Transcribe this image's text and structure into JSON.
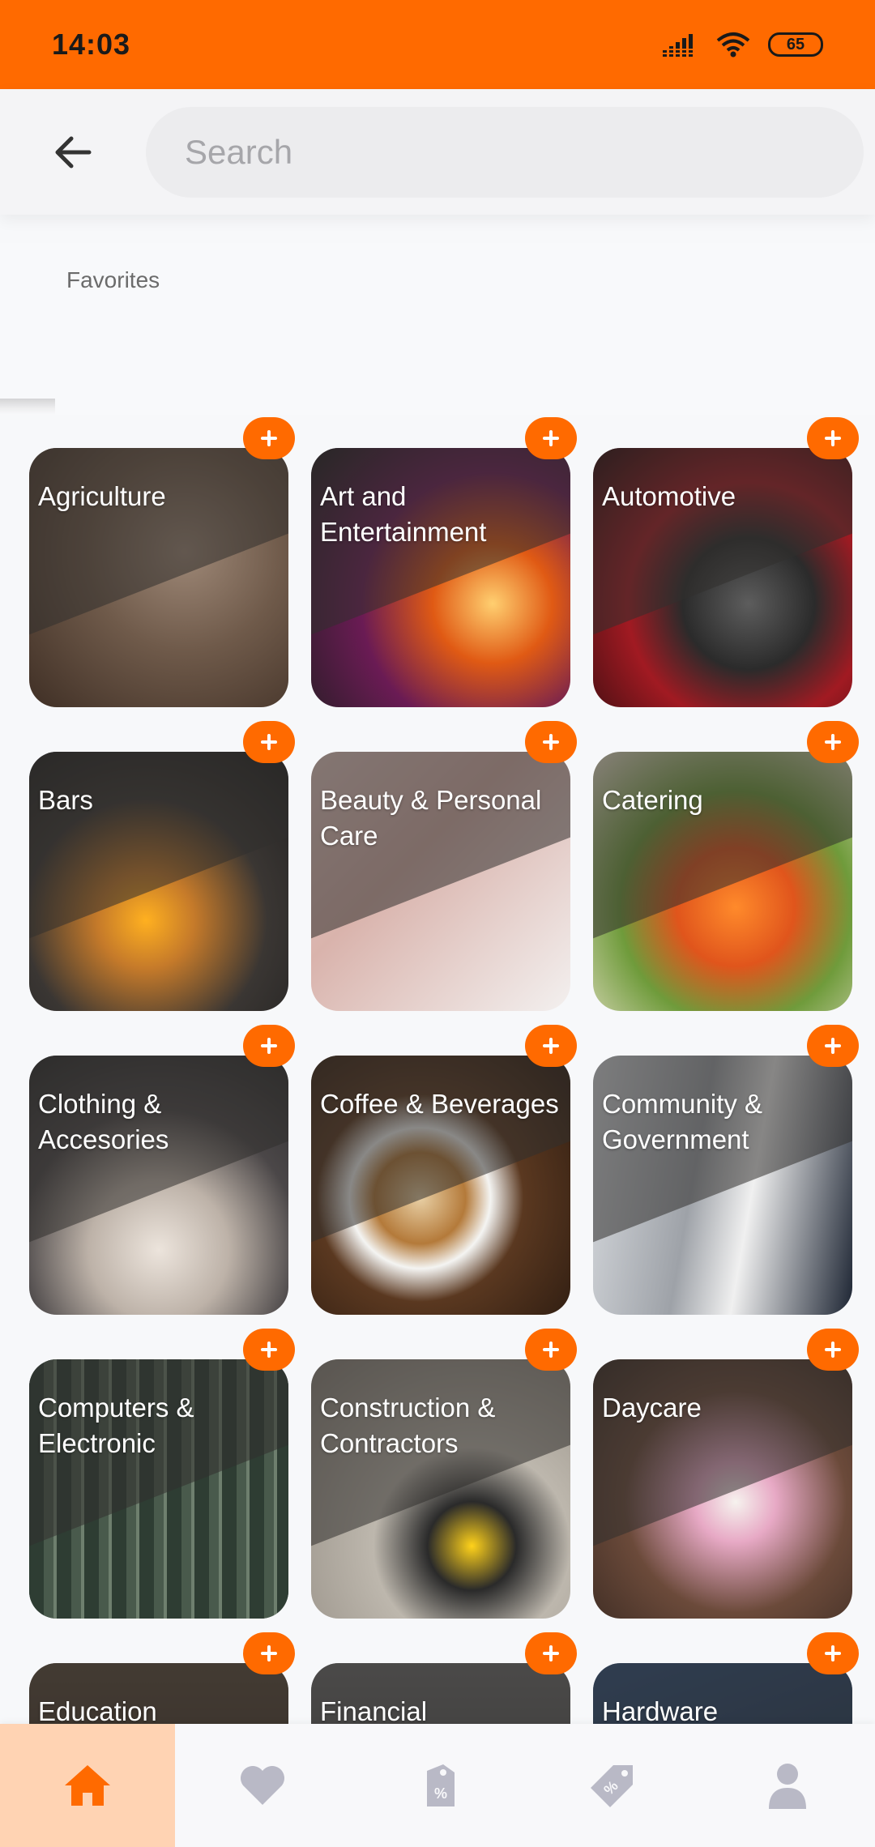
{
  "status_bar": {
    "time": "14:03",
    "battery": "65"
  },
  "search": {
    "placeholder": "Search"
  },
  "favorites": {
    "title": "Favorites"
  },
  "categories": [
    {
      "label": "Agriculture",
      "image": "wheat-photo"
    },
    {
      "label": "Art and Entertainment",
      "image": "saxophone-photo"
    },
    {
      "label": "Automotive",
      "image": "red-car-wheel-photo"
    },
    {
      "label": "Bars",
      "image": "beer-tap-photo"
    },
    {
      "label": "Beauty & Personal Care",
      "image": "manicure-photo"
    },
    {
      "label": "Catering",
      "image": "shrimp-salad-photo"
    },
    {
      "label": "Clothing & Accesories",
      "image": "sweater-woman-photo"
    },
    {
      "label": "Coffee & Beverages",
      "image": "latte-art-photo"
    },
    {
      "label": "Community & Government",
      "image": "columns-statue-photo"
    },
    {
      "label": "Computers & Electronic",
      "image": "circuit-board-photo"
    },
    {
      "label": "Construction & Contractors",
      "image": "tape-measure-photo"
    },
    {
      "label": "Daycare",
      "image": "child-drawing-photo"
    },
    {
      "label": "Education",
      "image": "books-photo"
    },
    {
      "label": "Financial",
      "image": "finance-photo"
    },
    {
      "label": "Hardware",
      "image": "tools-photo"
    }
  ],
  "bottom_nav": [
    {
      "icon": "home-icon",
      "active": true
    },
    {
      "icon": "heart-icon",
      "active": false
    },
    {
      "icon": "coupon-icon",
      "active": false
    },
    {
      "icon": "discount-tag-icon",
      "active": false
    },
    {
      "icon": "profile-icon",
      "active": false
    }
  ],
  "colors": {
    "accent": "#ff6a00",
    "nav_active_bg": "#ffd3b3",
    "nav_inactive_icon": "#b9b9c6"
  }
}
